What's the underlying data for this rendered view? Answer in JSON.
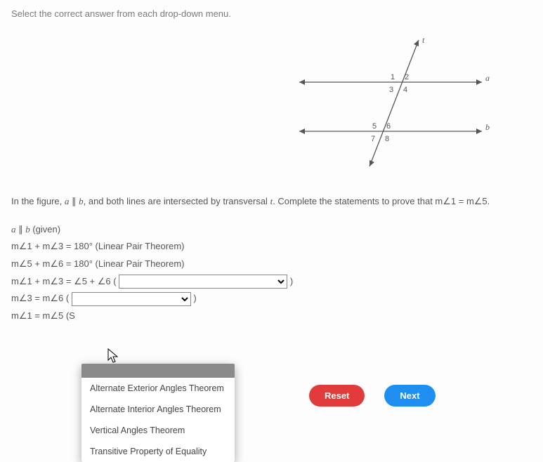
{
  "instruction": "Select the correct answer from each drop-down menu.",
  "figure": {
    "labels": {
      "t": "t",
      "a": "a",
      "b": "b",
      "n1": "1",
      "n2": "2",
      "n3": "3",
      "n4": "4",
      "n5": "5",
      "n6": "6",
      "n7": "7",
      "n8": "8"
    }
  },
  "prompt": {
    "p1": "In the figure, ",
    "a": "a",
    "par": " ∥ ",
    "b": "b",
    "p2": ", and both lines are intersected by transversal ",
    "t": "t",
    "p3": ". Complete the statements to prove that m∠1 = m∠5."
  },
  "proof": {
    "l1": {
      "a": "a",
      "par": " ∥ ",
      "b": "b",
      "given": " (given)"
    },
    "l2": "m∠1 + m∠3 = 180° (Linear Pair Theorem)",
    "l3": "m∠5 + m∠6 = 180° (Linear Pair Theorem)",
    "l4_pre": "m∠1 + m∠3 = ∠5 + ∠6 ( ",
    "l4_post": " )",
    "l5_pre": "m∠3 = m∠6 ( ",
    "l5_post": " )",
    "l6": "m∠1 = m∠5 (S"
  },
  "dropdown_options": [
    "Alternate Exterior Angles Theorem",
    "Alternate Interior Angles Theorem",
    "Vertical Angles Theorem",
    "Transitive Property of Equality"
  ],
  "buttons": {
    "reset": "Reset",
    "next": "Next"
  }
}
